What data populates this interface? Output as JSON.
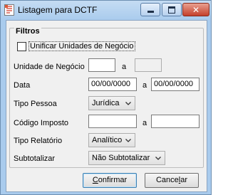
{
  "window": {
    "title": "Listagem para DCTF",
    "close_glyph": "✕"
  },
  "filters": {
    "group_label": "Filtros",
    "unify_checkbox_label": "Unificar Unidades de Negócio",
    "unify_checked": false,
    "business_unit": {
      "label": "Unidade de Negócio",
      "from": "",
      "to_label": "a",
      "to": ""
    },
    "date": {
      "label": "Data",
      "from": "00/00/0000",
      "to_label": "a",
      "to": "00/00/0000"
    },
    "person_type": {
      "label": "Tipo Pessoa",
      "selected": "Jurídica"
    },
    "tax_code": {
      "label": "Código Imposto",
      "from": "",
      "to_label": "a",
      "to": ""
    },
    "report_type": {
      "label": "Tipo Relatório",
      "selected": "Analítico"
    },
    "subtotal": {
      "label": "Subtotalizar",
      "selected": "Não Subtotalizar"
    }
  },
  "buttons": {
    "confirm_mnemonic": "C",
    "confirm_rest": "onfirmar",
    "cancel_prefix": "Cance",
    "cancel_mnemonic": "l",
    "cancel_rest": "ar"
  }
}
